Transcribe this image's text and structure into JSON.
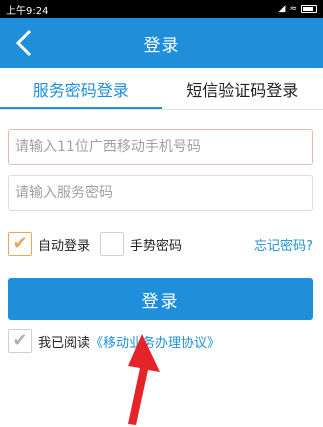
{
  "status_bar": {
    "time": "上午9:24",
    "signal": "◢",
    "wifi": "≈",
    "battery_icon": "battery-icon"
  },
  "app_bar": {
    "title": "登录",
    "back_icon": "chevron-left-icon"
  },
  "tabs": [
    {
      "label": "服务密码登录",
      "active": true
    },
    {
      "label": "短信验证码登录",
      "active": false
    }
  ],
  "form": {
    "phone_placeholder": "请输入11位广西移动手机号码",
    "password_placeholder": "请输入服务密码",
    "auto_login_label": "自动登录",
    "auto_login_checked": true,
    "gesture_password_label": "手势密码",
    "gesture_password_checked": false,
    "forgot_password": "忘记密码?"
  },
  "login_button": "登录",
  "agreement": {
    "prefix": "我已阅读",
    "link": "《移动业务办理协议》",
    "checked": true
  },
  "colors": {
    "primary": "#1e8fd8",
    "check_orange": "#f0a45a",
    "arrow_red": "#e5242a"
  }
}
